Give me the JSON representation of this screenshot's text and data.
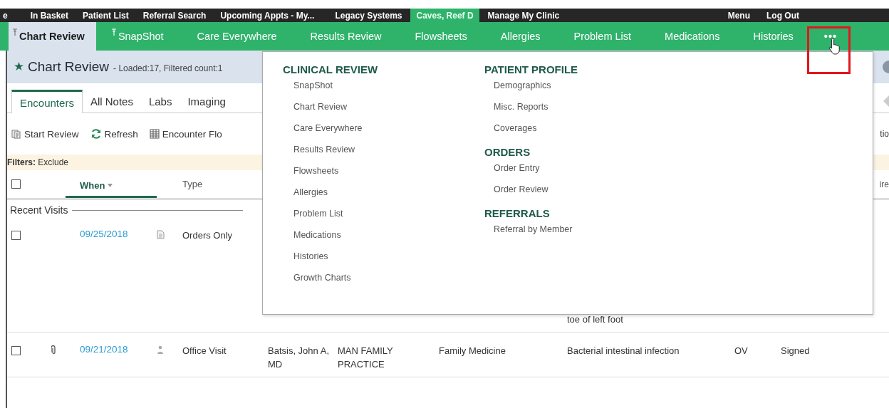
{
  "top_bar": {
    "items": [
      {
        "label": "e",
        "selected": false
      },
      {
        "label": "In Basket",
        "selected": false
      },
      {
        "label": "Patient List",
        "selected": false
      },
      {
        "label": "Referral Search",
        "selected": false
      },
      {
        "label": "Upcoming Appts - My...",
        "selected": false
      },
      {
        "label": "Legacy Systems",
        "selected": false
      },
      {
        "label": "Caves, Reef D",
        "selected": true
      },
      {
        "label": "Manage My Clinic",
        "selected": false
      }
    ],
    "right_items": [
      {
        "label": "Menu",
        "selected": false
      },
      {
        "label": "Log Out",
        "selected": false
      }
    ]
  },
  "tabs": [
    {
      "label": "Chart Review",
      "pinned": true,
      "selected": true,
      "highlighted": false
    },
    {
      "label": "SnapShot",
      "pinned": true,
      "selected": false,
      "highlighted": false
    },
    {
      "label": "Care Everywhere",
      "pinned": false,
      "selected": false,
      "highlighted": false
    },
    {
      "label": "Results Review",
      "pinned": false,
      "selected": false,
      "highlighted": false
    },
    {
      "label": "Flowsheets",
      "pinned": false,
      "selected": false,
      "highlighted": false
    },
    {
      "label": "Allergies",
      "pinned": false,
      "selected": false,
      "highlighted": false
    },
    {
      "label": "Problem List",
      "pinned": false,
      "selected": false,
      "highlighted": false
    },
    {
      "label": "Medications",
      "pinned": false,
      "selected": false,
      "highlighted": false
    },
    {
      "label": "Histories",
      "pinned": false,
      "selected": false,
      "highlighted": false
    },
    {
      "label": "•••",
      "pinned": false,
      "selected": false,
      "highlighted": true
    }
  ],
  "more_menu": {
    "columns": [
      {
        "sections": [
          {
            "heading": "CLINICAL REVIEW",
            "items": [
              "SnapShot",
              "Chart Review",
              "Care Everywhere",
              "Results Review",
              "Flowsheets",
              "Allergies",
              "Problem List",
              "Medications",
              "Histories",
              "Growth Charts"
            ]
          }
        ]
      },
      {
        "sections": [
          {
            "heading": "PATIENT PROFILE",
            "items": [
              "Demographics",
              "Misc. Reports",
              "Coverages"
            ]
          },
          {
            "heading": "ORDERS",
            "items": [
              "Order Entry",
              "Order Review"
            ]
          },
          {
            "heading": "REFERRALS",
            "items": [
              "Referral by Member"
            ]
          }
        ]
      }
    ]
  },
  "activity": {
    "title": "Chart Review",
    "subtitle": "- Loaded:17, Filtered count:1",
    "tabs": [
      {
        "label": "Encounters",
        "selected": true
      },
      {
        "label": "All Notes",
        "selected": false
      },
      {
        "label": "Labs",
        "selected": false
      },
      {
        "label": "Imaging",
        "selected": false
      }
    ],
    "toolbar": [
      "Start Review",
      "Refresh",
      "Encounter Flo"
    ],
    "toolbar_edge_text": "tio",
    "filters": {
      "label": "Filters:",
      "value": "Exclude"
    },
    "header": {
      "checked": false,
      "columns": [
        {
          "label": "When",
          "sorted": true
        },
        {
          "label": "Type",
          "sorted": false
        }
      ],
      "edge_text": "ire"
    },
    "groups": [
      {
        "label": "Recent Visits",
        "rows": [
          {
            "checked": false,
            "attachment": false,
            "date": "09/25/2018",
            "type": "Orders Only",
            "diagnosis": "toe of left foot"
          },
          {
            "checked": false,
            "attachment": true,
            "date": "09/21/2018",
            "type": "Office Visit",
            "provider": "Batsis, John A, MD",
            "department": "MAN FAMILY PRACTICE",
            "specialty": "Family Medicine",
            "diagnosis": "Bacterial intestinal infection",
            "column_9": "OV",
            "status": "Signed"
          }
        ]
      }
    ]
  }
}
